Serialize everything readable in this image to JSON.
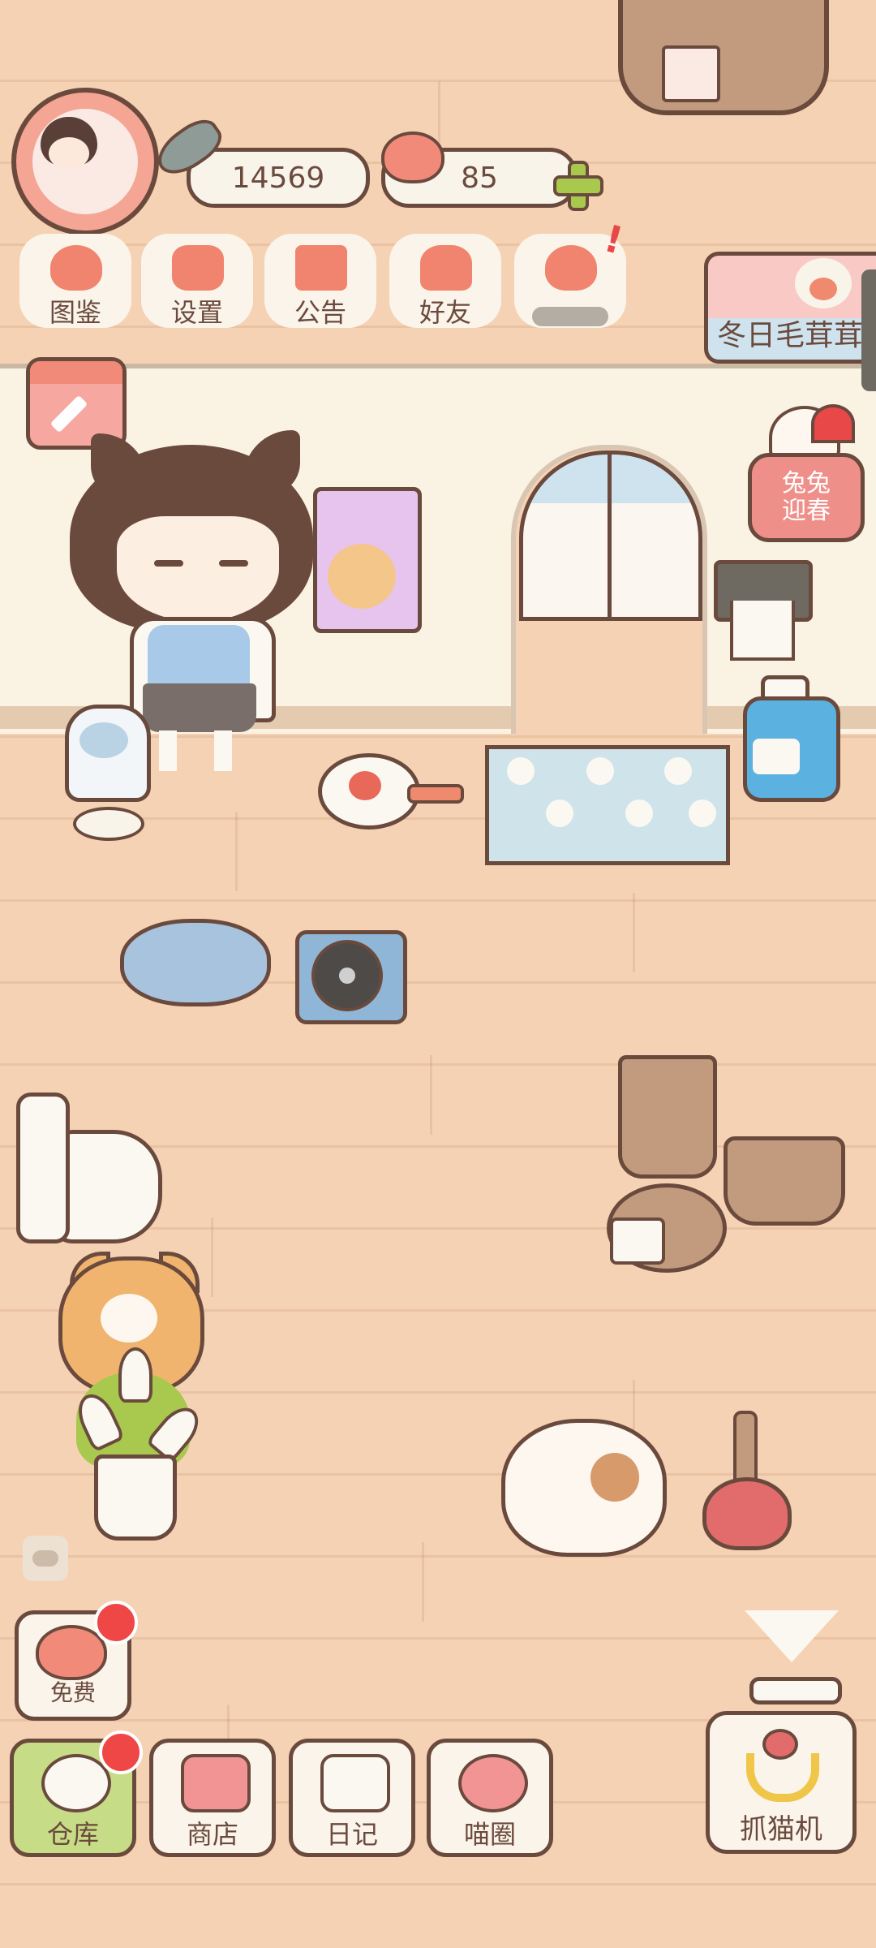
{
  "hud": {
    "fish_count": "14569",
    "heart_count": "85"
  },
  "top_menu": [
    {
      "label": "图鉴",
      "icon": "cat-book-icon"
    },
    {
      "label": "设置",
      "icon": "gear-icon"
    },
    {
      "label": "公告",
      "icon": "gift-icon"
    },
    {
      "label": "好友",
      "icon": "friends-icon"
    },
    {
      "label": "",
      "icon": "heart-hands-icon"
    }
  ],
  "event_banner": {
    "label": "冬日毛茸茸"
  },
  "spring_event": {
    "line1": "兔兔",
    "line2": "迎春"
  },
  "free_button": {
    "label": "免费"
  },
  "bottom_nav": [
    {
      "label": "仓库",
      "icon": "storage-icon",
      "active": true
    },
    {
      "label": "商店",
      "icon": "shop-icon",
      "active": false
    },
    {
      "label": "日记",
      "icon": "diary-icon",
      "active": false
    },
    {
      "label": "喵圈",
      "icon": "cat-planet-icon",
      "active": false
    }
  ],
  "claw_machine": {
    "label": "抓猫机"
  },
  "colors": {
    "floor": "#f6d2b4",
    "outline": "#6b4a3e",
    "accent_red": "#ef4646",
    "accent_green": "#a8c84e",
    "active_tab": "#c7dc86"
  }
}
